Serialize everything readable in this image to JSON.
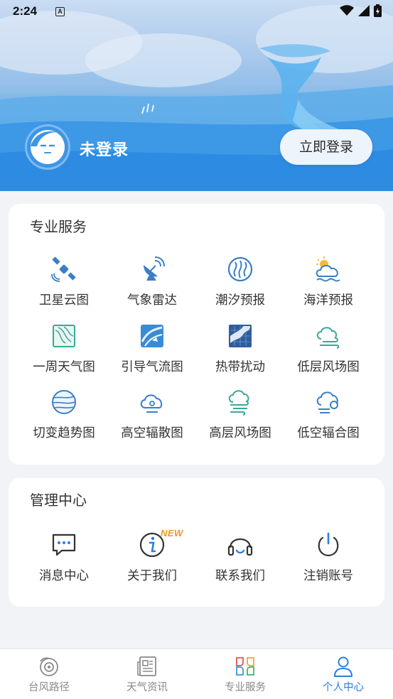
{
  "status_bar": {
    "time": "2:24",
    "notification_badge": "A"
  },
  "profile": {
    "username": "未登录",
    "login_button": "立即登录"
  },
  "pro_services": {
    "title": "专业服务",
    "items": [
      {
        "label": "卫星云图",
        "icon": "satellite-icon"
      },
      {
        "label": "气象雷达",
        "icon": "radar-dish-icon"
      },
      {
        "label": "潮汐预报",
        "icon": "tide-icon"
      },
      {
        "label": "海洋预报",
        "icon": "sun-cloud-wave-icon"
      },
      {
        "label": "一周天气图",
        "icon": "weather-map-icon"
      },
      {
        "label": "引导气流图",
        "icon": "airflow-map-icon"
      },
      {
        "label": "热带扰动",
        "icon": "tropical-map-icon"
      },
      {
        "label": "低层风场图",
        "icon": "cloud-wind-icon"
      },
      {
        "label": "切变趋势图",
        "icon": "globe-lines-icon"
      },
      {
        "label": "高空辐散图",
        "icon": "cloud-divergence-icon"
      },
      {
        "label": "高层风场图",
        "icon": "cloud-wind-high-icon"
      },
      {
        "label": "低空辐合图",
        "icon": "cloud-convergence-icon"
      }
    ]
  },
  "management": {
    "title": "管理中心",
    "items": [
      {
        "label": "消息中心",
        "icon": "message-icon"
      },
      {
        "label": "关于我们",
        "icon": "info-icon",
        "badge": "NEW"
      },
      {
        "label": "联系我们",
        "icon": "headset-icon"
      },
      {
        "label": "注销账号",
        "icon": "power-icon"
      }
    ]
  },
  "bottom_nav": {
    "items": [
      {
        "label": "台风路径",
        "icon": "typhoon-icon",
        "active": false
      },
      {
        "label": "天气资讯",
        "icon": "news-icon",
        "active": false
      },
      {
        "label": "专业服务",
        "icon": "services-grid-icon",
        "active": false
      },
      {
        "label": "个人中心",
        "icon": "person-icon",
        "active": true
      }
    ]
  },
  "colors": {
    "accent": "#2a7fe0",
    "icon_blue": "#3a7fc6",
    "icon_teal": "#3aa89a",
    "badge_orange": "#f5932b"
  }
}
